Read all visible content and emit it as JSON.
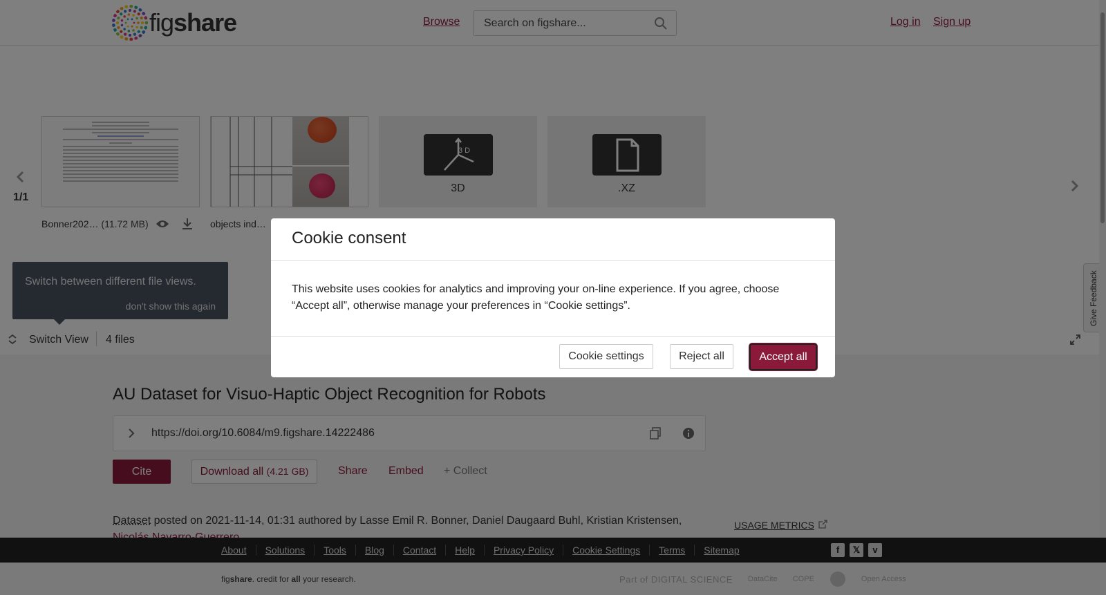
{
  "header": {
    "logo_text_light": "fig",
    "logo_text_bold": "share",
    "browse": "Browse",
    "search_placeholder": "Search on figshare...",
    "login": "Log in",
    "signup": "Sign up"
  },
  "carousel": {
    "page_indicator": "1/1",
    "files": [
      {
        "name": "Bonner202…",
        "size": "(11.72 MB)"
      },
      {
        "name": "objects ind…"
      },
      {
        "type_label": "3D"
      },
      {
        "type_label": ".XZ"
      }
    ],
    "tooltip": {
      "text": "Switch between different file views.",
      "dismiss": "don't show this again"
    },
    "switch_view": "Switch View",
    "file_count": "4 files"
  },
  "article": {
    "title": "AU Dataset for Visuo-Haptic Object Recognition for Robots",
    "doi": "https://doi.org/10.6084/m9.figshare.14222486",
    "cite": "Cite",
    "download_all": "Download all",
    "download_size": "(4.21 GB)",
    "share": "Share",
    "embed": "Embed",
    "collect": "+ Collect",
    "item_type": "Dataset",
    "meta": "posted on 2021-11-14, 01:31 authored by Lasse Emil R. Bonner, Daniel Daugaard Buhl, Kristian Kristensen,",
    "meta_cont": "Nicolás Navarro-Guerrero",
    "usage_metrics": "USAGE METRICS"
  },
  "feedback": "Give Feedback",
  "footer": {
    "links": [
      "About",
      "Solutions",
      "Tools",
      "Blog",
      "Contact",
      "Help",
      "Privacy Policy",
      "Cookie Settings",
      "Terms",
      "Sitemap"
    ],
    "tagline_fig": "fig",
    "tagline_share": "share",
    "tagline_mid": ". credit for ",
    "tagline_all": "all",
    "tagline_end": " your research.",
    "partners": [
      "Part of DIGITAL SCIENCE",
      "DataCite",
      "COPE",
      "Open Access"
    ]
  },
  "cookie": {
    "title": "Cookie consent",
    "body": "This website uses cookies for analytics and improving your on-line experience. If you agree, choose “Accept all”, otherwise manage your preferences in “Cookie settings”.",
    "settings": "Cookie settings",
    "reject": "Reject all",
    "accept": "Accept all"
  },
  "colors": {
    "brand": "#8b1a3a",
    "overlay": "rgba(0,0,0,0.5)"
  }
}
